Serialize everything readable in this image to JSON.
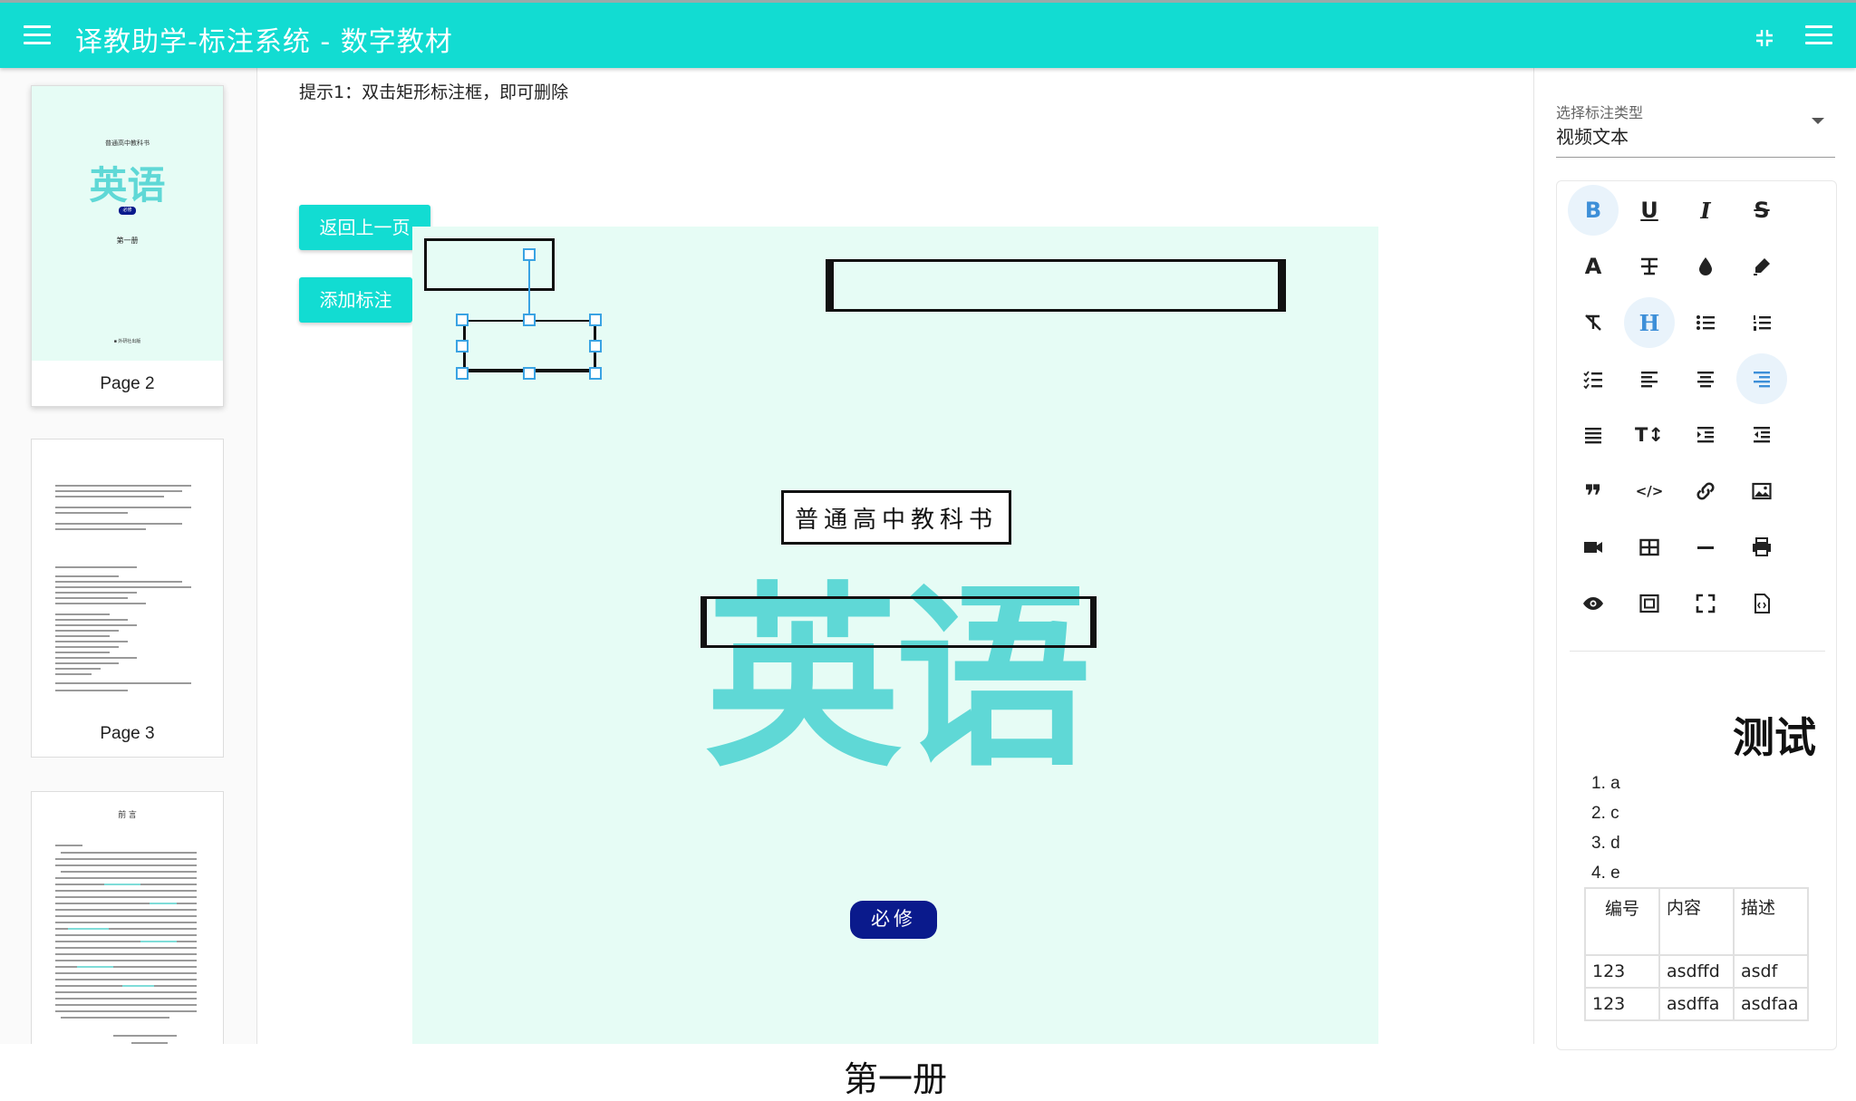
{
  "header": {
    "title": "译教助学-标注系统 - 数字教材",
    "menu_icon": "menu-icon",
    "fullscreen_exit_icon": "fullscreen-exit-icon",
    "right_menu_icon": "menu-icon"
  },
  "sidebar": {
    "pages": [
      {
        "label": "Page 2",
        "thumb_kind": "cover",
        "selected": true,
        "thumb": {
          "series": "普通高中教科书",
          "title": "英语",
          "badge": "必修",
          "volume": "第一册",
          "publisher": "■ 外研社出版"
        }
      },
      {
        "label": "Page 3",
        "thumb_kind": "copyright",
        "selected": false
      },
      {
        "label": "",
        "thumb_kind": "preface",
        "selected": false,
        "thumb": {
          "heading": "前 言"
        }
      }
    ]
  },
  "main": {
    "hint": "提示1：双击矩形标注框，即可删除",
    "back_button": "返回上一页",
    "add_button": "添加标注",
    "page": {
      "background": "#e6fcf5",
      "series": "普通高中教科书",
      "title": "英语",
      "badge": "必修",
      "volume": "第一册",
      "title_color": "#5fd8d6",
      "badge_color": "#0a1a8c"
    }
  },
  "right_panel": {
    "select_label": "选择标注类型",
    "select_value": "视频文本",
    "toolbar": [
      [
        "bold",
        "underline",
        "italic",
        "strikethrough"
      ],
      [
        "font-color",
        "clear-format",
        "ink-color",
        "highlight"
      ],
      [
        "remove-format",
        "heading",
        "bullet-list",
        "numbered-list"
      ],
      [
        "todo-list",
        "align-left",
        "align-center",
        "align-right"
      ],
      [
        "justify",
        "line-height",
        "indent",
        "outdent"
      ],
      [
        "quote",
        "code",
        "link",
        "image"
      ],
      [
        "video",
        "table",
        "horizontal-rule",
        "print"
      ],
      [
        "preview",
        "fit-screen",
        "fullscreen",
        "html-file"
      ]
    ],
    "active_tools": [
      "bold",
      "heading",
      "align-right"
    ],
    "preview": {
      "title": "测试",
      "list": [
        "1. a",
        "2. c",
        "3. d",
        "4. e"
      ],
      "table_headers": [
        "编号",
        "内容",
        "描述"
      ],
      "table_rows": [
        [
          "123",
          "asdffd",
          "asdf"
        ],
        [
          "123",
          "asdffa",
          "asdfaa"
        ]
      ]
    }
  }
}
